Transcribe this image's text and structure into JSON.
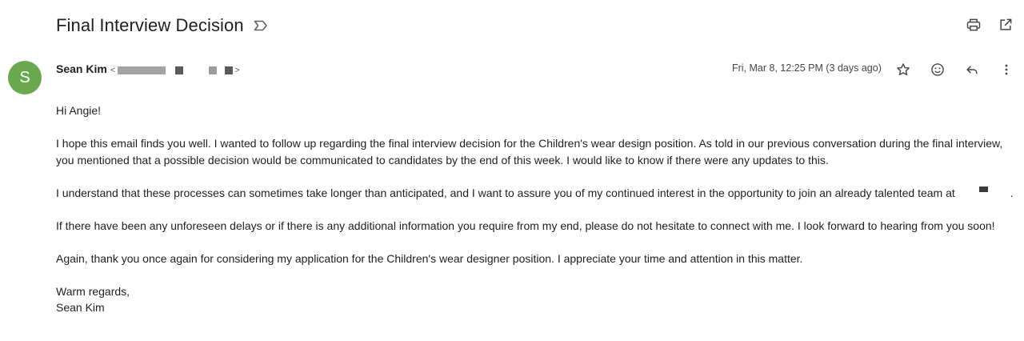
{
  "email": {
    "subject": "Final Interview Decision",
    "sender": {
      "avatar_letter": "S",
      "name": "Sean Kim",
      "email_open": "<",
      "email_close": ">"
    },
    "date": "Fri, Mar 8, 12:25 PM (3 days ago)",
    "body": {
      "greeting": "Hi Angie!",
      "p1": "I hope this email finds you well. I wanted to follow up regarding the final interview decision for the Children's wear design position. As told in our previous conversation during the final interview, you mentioned that a possible decision would be communicated to candidates by the end of this week. I would like to know if there were any updates to this.",
      "p2_before": "I understand that these processes can sometimes take longer than anticipated, and I want to assure you of my continued interest in the opportunity to join an already talented team at",
      "p2_after": ".",
      "p3": "If there have been any unforeseen delays or if there is any additional information you require from my end, please do not hesitate to connect with me. I look forward to hearing from you soon!",
      "p4": "Again, thank you once again for considering my application for the Children's wear designer position. I appreciate your time and attention in this matter.",
      "closing": "Warm regards,",
      "signature": "Sean Kim"
    }
  },
  "colors": {
    "avatar_bg": "#6aa84f",
    "text": "#1f1f1f",
    "meta_text": "#444746"
  },
  "icons": {
    "label": "label-important-icon",
    "print": "print-icon",
    "open_new_window": "open-in-new-icon",
    "star": "star-icon",
    "emoji": "emoji-reaction-icon",
    "reply": "reply-icon",
    "more": "more-vert-icon"
  }
}
